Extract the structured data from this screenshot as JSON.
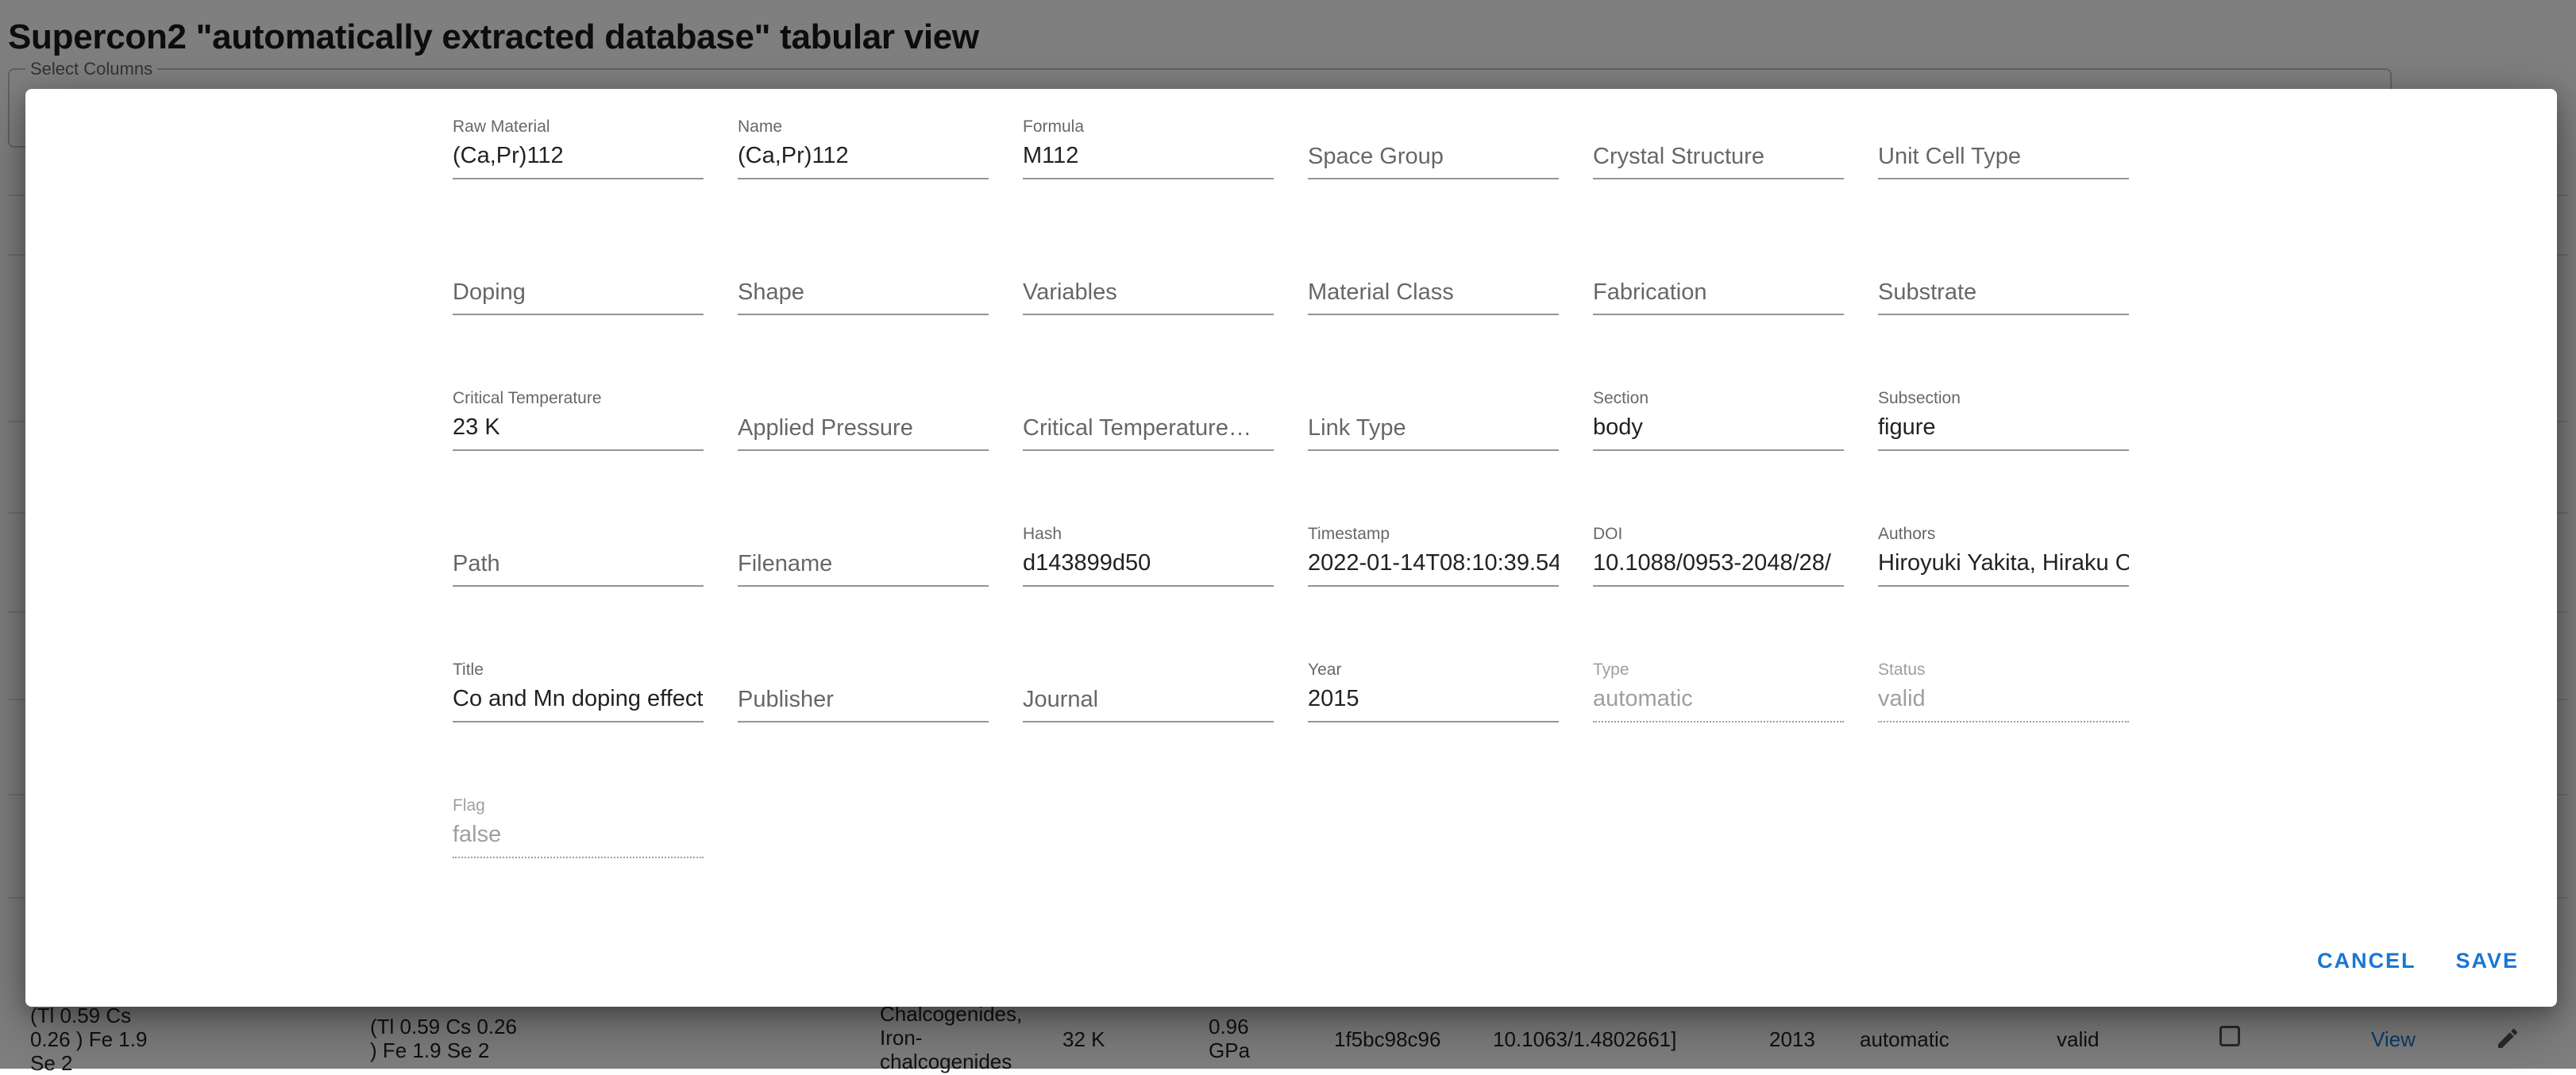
{
  "page": {
    "title": "Supercon2 \"automatically extracted database\" tabular view",
    "select_columns_label": "Select Columns"
  },
  "background_row": {
    "raw_material": "(Tl 0.59 Cs\n0.26 ) Fe 1.9\nSe 2",
    "formula": "(Tl 0.59 Cs 0.26\n) Fe 1.9 Se 2",
    "material_class": "Chalcogenides,\nIron-\nchalcogenides",
    "critical_temperature": "32 K",
    "applied_pressure": "0.96\nGPa",
    "hash": "1f5bc98c96",
    "doi": "10.1063/1.4802661]",
    "year": "2013",
    "type": "automatic",
    "status": "valid",
    "view_label": "View",
    "edit_icon": "pencil-icon"
  },
  "dialog": {
    "fields": [
      {
        "name": "raw-material-field",
        "label": "Raw Material",
        "value": "(Ca,Pr)112"
      },
      {
        "name": "name-field",
        "label": "Name",
        "value": "(Ca,Pr)112"
      },
      {
        "name": "formula-field",
        "label": "Formula",
        "value": "M112"
      },
      {
        "name": "space-group-field",
        "label": "Space Group",
        "value": ""
      },
      {
        "name": "crystal-structure-field",
        "label": "Crystal Structure",
        "value": ""
      },
      {
        "name": "unit-cell-type-field",
        "label": "Unit Cell Type",
        "value": ""
      },
      {
        "name": "doping-field",
        "label": "Doping",
        "value": ""
      },
      {
        "name": "shape-field",
        "label": "Shape",
        "value": ""
      },
      {
        "name": "variables-field",
        "label": "Variables",
        "value": ""
      },
      {
        "name": "material-class-field",
        "label": "Material Class",
        "value": ""
      },
      {
        "name": "fabrication-field",
        "label": "Fabrication",
        "value": ""
      },
      {
        "name": "substrate-field",
        "label": "Substrate",
        "value": ""
      },
      {
        "name": "critical-temperature-field",
        "label": "Critical Temperature",
        "value": "23 K"
      },
      {
        "name": "applied-pressure-field",
        "label": "Applied Pressure",
        "value": ""
      },
      {
        "name": "critical-temperature-measurement-field",
        "label": "Critical Temperature…",
        "value": ""
      },
      {
        "name": "link-type-field",
        "label": "Link Type",
        "value": ""
      },
      {
        "name": "section-field",
        "label": "Section",
        "value": "body"
      },
      {
        "name": "subsection-field",
        "label": "Subsection",
        "value": "figure"
      },
      {
        "name": "path-field",
        "label": "Path",
        "value": ""
      },
      {
        "name": "filename-field",
        "label": "Filename",
        "value": ""
      },
      {
        "name": "hash-field",
        "label": "Hash",
        "value": "d143899d50"
      },
      {
        "name": "timestamp-field",
        "label": "Timestamp",
        "value": "2022-01-14T08:10:39.54"
      },
      {
        "name": "doi-field",
        "label": "DOI",
        "value": "10.1088/0953-2048/28/"
      },
      {
        "name": "authors-field",
        "label": "Authors",
        "value": "Hiroyuki Yakita, Hiraku O"
      },
      {
        "name": "title-field",
        "label": "Title",
        "value": "Co and Mn doping effect"
      },
      {
        "name": "publisher-field",
        "label": "Publisher",
        "value": ""
      },
      {
        "name": "journal-field",
        "label": "Journal",
        "value": ""
      },
      {
        "name": "year-field",
        "label": "Year",
        "value": "2015"
      },
      {
        "name": "type-field",
        "label": "Type",
        "value": "automatic",
        "disabled": true
      },
      {
        "name": "status-field",
        "label": "Status",
        "value": "valid",
        "disabled": true
      },
      {
        "name": "flag-field",
        "label": "Flag",
        "value": "false",
        "disabled": true
      }
    ],
    "cancel_label": "CANCEL",
    "save_label": "SAVE"
  },
  "colors": {
    "accent": "#1976d2",
    "backdrop": "rgba(0,0,0,0.5)"
  }
}
